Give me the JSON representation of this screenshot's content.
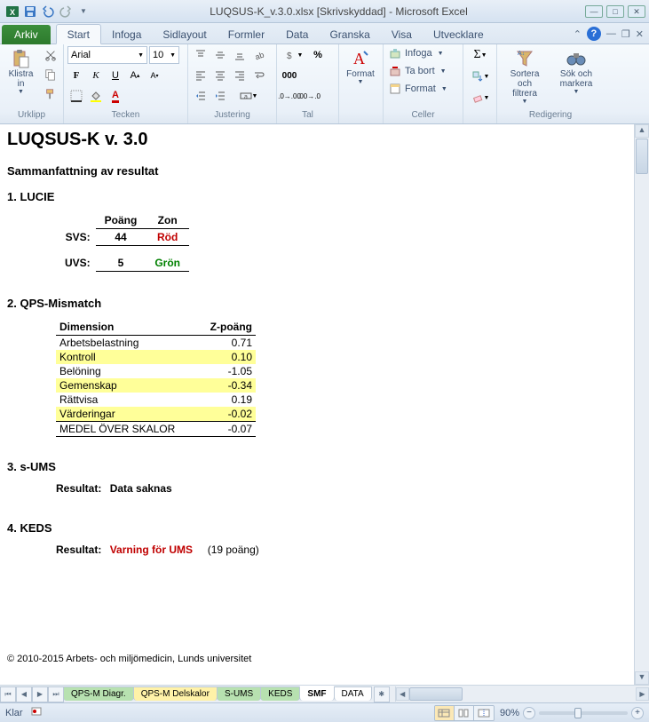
{
  "titlebar": {
    "title": "LUQSUS-K_v.3.0.xlsx  [Skrivskyddad] - Microsoft Excel"
  },
  "tabs": {
    "arkiv": "Arkiv",
    "items": [
      "Start",
      "Infoga",
      "Sidlayout",
      "Formler",
      "Data",
      "Granska",
      "Visa",
      "Utvecklare"
    ]
  },
  "ribbon": {
    "clipboard": {
      "paste": "Klistra\nin",
      "label": "Urklipp"
    },
    "font": {
      "name": "Arial",
      "size": "10",
      "label": "Tecken"
    },
    "align": {
      "label": "Justering"
    },
    "number": {
      "label": "Tal"
    },
    "styles": {
      "format": "Format",
      "label": ""
    },
    "cells": {
      "insert": "Infoga",
      "delete": "Ta bort",
      "format": "Format",
      "label": "Celler"
    },
    "editing": {
      "sort": "Sortera och\nfiltrera",
      "find": "Sök och\nmarkera",
      "label": "Redigering"
    }
  },
  "sheet": {
    "title": "LUQSUS-K  v. 3.0",
    "summary": "Sammanfattning av resultat",
    "s1": {
      "heading": "1. LUCIE",
      "colPoang": "Poäng",
      "colZon": "Zon",
      "rows": [
        {
          "lbl": "SVS:",
          "poang": "44",
          "zon": "Röd",
          "zonClass": "red"
        },
        {
          "lbl": "UVS:",
          "poang": "5",
          "zon": "Grön",
          "zonClass": "green"
        }
      ]
    },
    "s2": {
      "heading": "2. QPS-Mismatch",
      "colDim": "Dimension",
      "colZ": "Z-poäng",
      "rows": [
        {
          "dim": "Arbetsbelastning",
          "z": "0.71",
          "hl": false
        },
        {
          "dim": "Kontroll",
          "z": "0.10",
          "hl": true
        },
        {
          "dim": "Belöning",
          "z": "-1.05",
          "hl": false
        },
        {
          "dim": "Gemenskap",
          "z": "-0.34",
          "hl": true
        },
        {
          "dim": "Rättvisa",
          "z": "0.19",
          "hl": false
        },
        {
          "dim": "Värderingar",
          "z": "-0.02",
          "hl": true
        }
      ],
      "medel": {
        "dim": "MEDEL ÖVER SKALOR",
        "z": "-0.07"
      }
    },
    "s3": {
      "heading": "3. s-UMS",
      "lbl": "Resultat:",
      "val": "Data saknas"
    },
    "s4": {
      "heading": "4. KEDS",
      "lbl": "Resultat:",
      "val": "Varning för UMS",
      "extra": "(19 poäng)"
    },
    "copyright": "© 2010-2015 Arbets- och miljömedicin, Lunds universitet"
  },
  "sheetTabs": [
    "QPS-M Diagr.",
    "QPS-M Delskalor",
    "S-UMS",
    "KEDS",
    "SMF",
    "DATA"
  ],
  "status": {
    "ready": "Klar",
    "zoom": "90%"
  }
}
